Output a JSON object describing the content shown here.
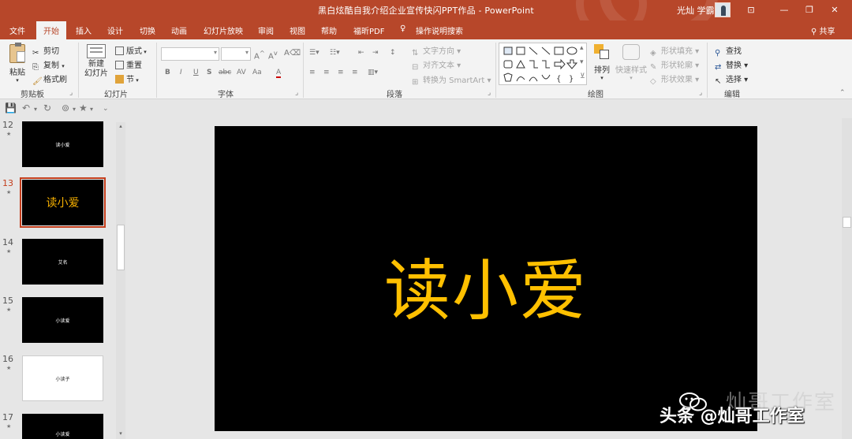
{
  "window": {
    "title": "黑白炫酷自我介绍企业宣传快闪PPT作品  -  PowerPoint",
    "user": "光灿 学霸"
  },
  "tabs": [
    {
      "label": "文件"
    },
    {
      "label": "开始"
    },
    {
      "label": "插入"
    },
    {
      "label": "设计"
    },
    {
      "label": "切换"
    },
    {
      "label": "动画"
    },
    {
      "label": "幻灯片放映"
    },
    {
      "label": "审阅"
    },
    {
      "label": "视图"
    },
    {
      "label": "帮助"
    },
    {
      "label": "福昕PDF"
    },
    {
      "label": "操作说明搜索"
    }
  ],
  "share_label": "共享",
  "ribbon": {
    "clipboard": {
      "paste": "粘贴",
      "cut": "剪切",
      "copy": "复制",
      "format_painter": "格式刷",
      "label": "剪贴板"
    },
    "slides": {
      "new_slide_1": "新建",
      "new_slide_2": "幻灯片",
      "layout": "版式",
      "reset": "重置",
      "section": "节",
      "label": "幻灯片"
    },
    "font": {
      "label": "字体",
      "bold": "B",
      "italic": "I",
      "underline": "U",
      "shadow": "S",
      "strike": "abc",
      "spacing": "AV",
      "case": "Aa",
      "font_color": "A"
    },
    "paragraph": {
      "label": "段落",
      "text_direction": "文字方向",
      "align_text": "对齐文本",
      "smartart": "转换为 SmartArt"
    },
    "drawing": {
      "label": "绘图",
      "arrange": "排列",
      "quick_styles": "快速样式",
      "shape_fill": "形状填充",
      "shape_outline": "形状轮廓",
      "shape_effects": "形状效果"
    },
    "editing": {
      "label": "编辑",
      "find": "查找",
      "replace": "替换",
      "select": "选择"
    }
  },
  "slides": [
    {
      "num": "12",
      "text": "读小爱"
    },
    {
      "num": "13",
      "text": "读小爱"
    },
    {
      "num": "14",
      "text": "艾名"
    },
    {
      "num": "15",
      "text": "小读爱"
    },
    {
      "num": "16",
      "text": "小读子"
    },
    {
      "num": "17",
      "text": "小读爱"
    }
  ],
  "main_slide": {
    "title": "读小爱",
    "title_color": "#ffc000"
  },
  "watermark": {
    "ghost": "灿哥工作室",
    "text": "头条 @灿哥工作室"
  },
  "colors": {
    "accent": "#b7472a",
    "selection": "#c43e1c"
  }
}
